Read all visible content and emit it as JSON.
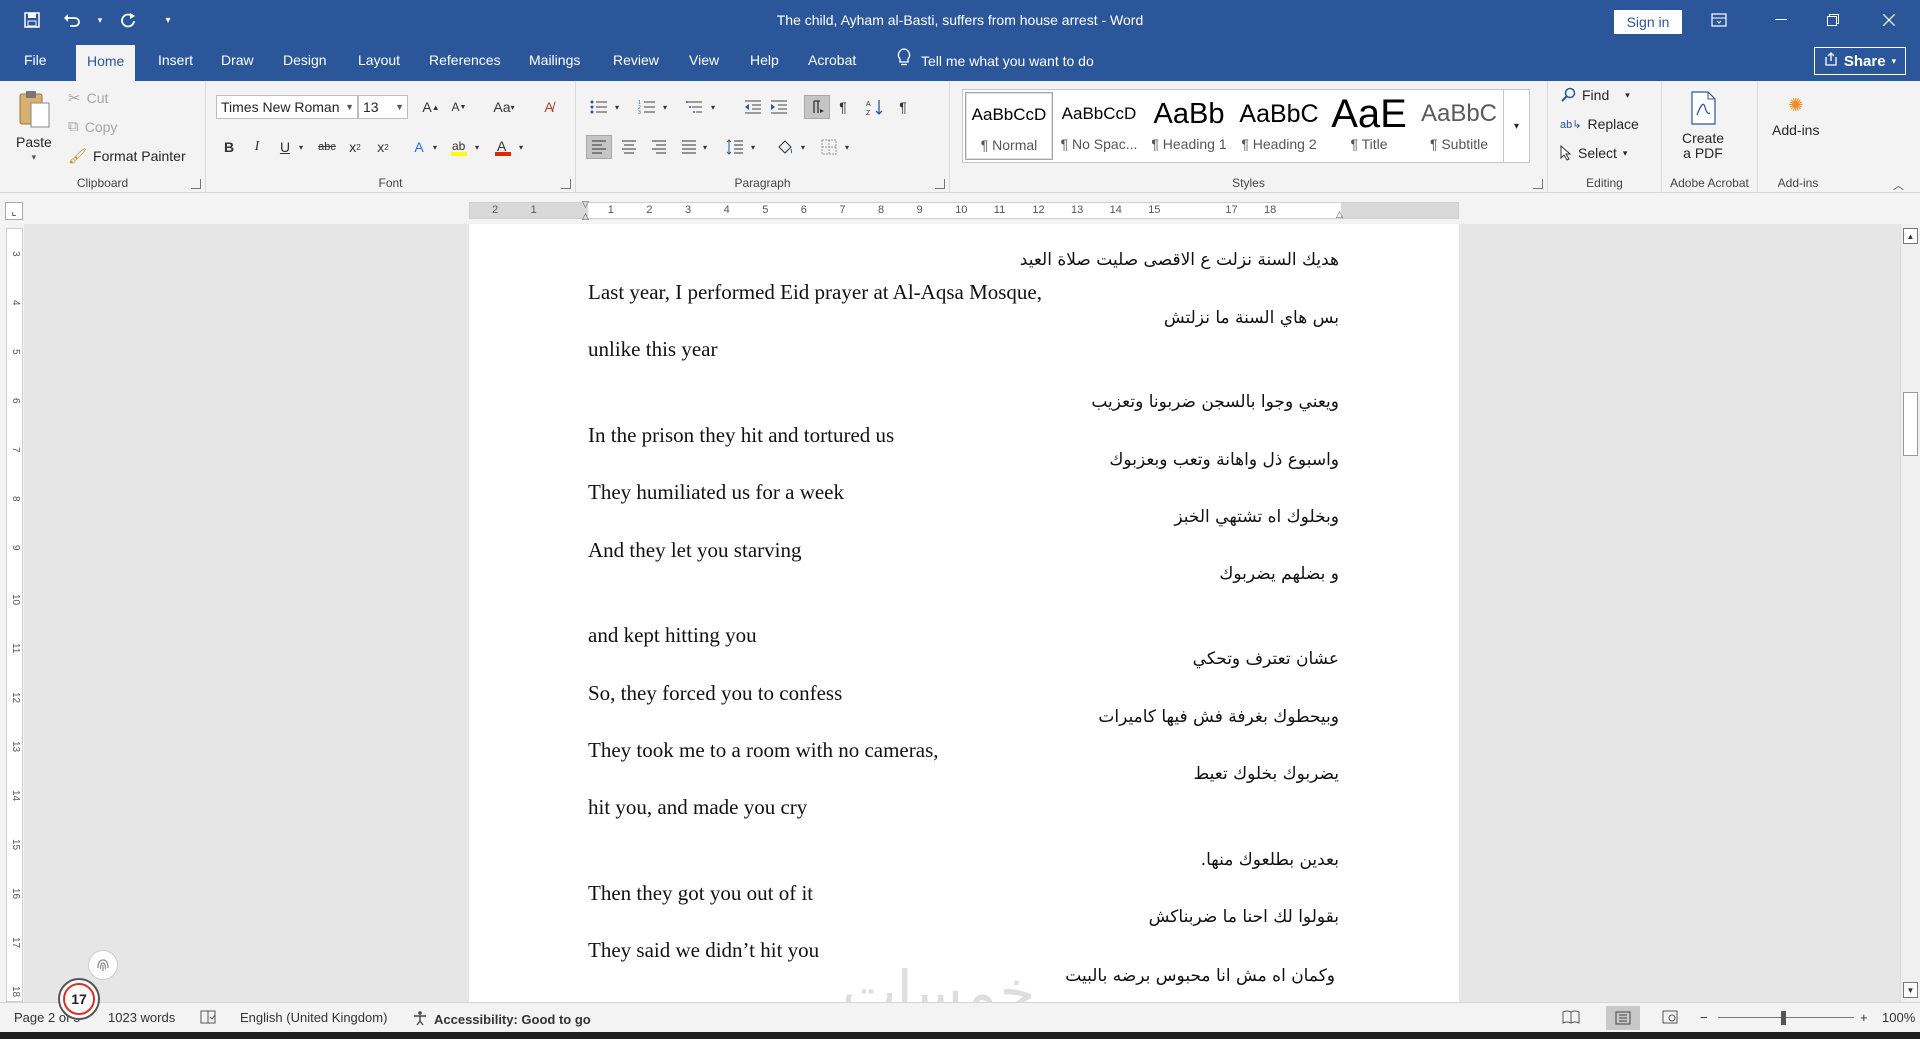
{
  "titlebar": {
    "title": "The child, Ayham al-Basti, suffers from house arrest  -  Word",
    "sign_in": "Sign in",
    "qat_icons": [
      "save-icon",
      "undo-icon",
      "redo-icon",
      "customize-icon"
    ]
  },
  "tabs": [
    "File",
    "Home",
    "Insert",
    "Draw",
    "Design",
    "Layout",
    "References",
    "Mailings",
    "Review",
    "View",
    "Help",
    "Acrobat"
  ],
  "active_tab": "Home",
  "tell_me": "Tell me what you want to do",
  "share": "Share",
  "clipboard": {
    "label": "Clipboard",
    "paste": "Paste",
    "cut": "Cut",
    "copy": "Copy",
    "format_painter": "Format Painter"
  },
  "font": {
    "label": "Font",
    "name": "Times New Roman",
    "size": "13"
  },
  "paragraph": {
    "label": "Paragraph"
  },
  "styles": {
    "label": "Styles",
    "items": [
      {
        "preview": "AaBbCcD",
        "name": "¶ Normal"
      },
      {
        "preview": "AaBbCcD",
        "name": "¶ No Spac..."
      },
      {
        "preview": "AaBb",
        "name": "¶ Heading 1"
      },
      {
        "preview": "AaBbC",
        "name": "¶ Heading 2"
      },
      {
        "preview": "AaE",
        "name": "¶ Title"
      },
      {
        "preview": "AaBbC",
        "name": "¶ Subtitle"
      }
    ]
  },
  "editing": {
    "label": "Editing",
    "find": "Find",
    "replace": "Replace",
    "select": "Select"
  },
  "acrobat": {
    "label": "Adobe Acrobat",
    "create_line1": "Create",
    "create_line2": "a PDF"
  },
  "addins": {
    "label": "Add-ins",
    "button": "Add-ins"
  },
  "ruler_numbers": [
    "2",
    "1",
    "",
    "1",
    "2",
    "3",
    "4",
    "5",
    "6",
    "7",
    "8",
    "9",
    "10",
    "11",
    "12",
    "13",
    "14",
    "15",
    "",
    "17",
    "18"
  ],
  "document": {
    "lines": [
      {
        "lang": "ar",
        "text": "هديك السنة نزلت ع الاقصى صليت صلاة العيد"
      },
      {
        "lang": "en",
        "text": "Last year, I performed Eid prayer at Al-Aqsa Mosque,"
      },
      {
        "lang": "ar",
        "text": "بس هاي السنة ما نزلتش"
      },
      {
        "lang": "en",
        "text": "unlike this year"
      },
      {
        "lang": "ar",
        "text": "ويعني وجوا بالسجن ضربونا وتعزيب"
      },
      {
        "lang": "en",
        "text": "In the prison they hit and tortured us"
      },
      {
        "lang": "ar",
        "text": "واسبوع ذل واهانة وتعب وبعزبوك"
      },
      {
        "lang": "en",
        "text": "They humiliated us for a week"
      },
      {
        "lang": "ar",
        "text": "وبخلوك اه تشتهي الخبز"
      },
      {
        "lang": "en",
        "text": "And they let you starving"
      },
      {
        "lang": "ar",
        "text": "و بضلهم يضربوك"
      },
      {
        "lang": "en",
        "text": "and kept hitting you"
      },
      {
        "lang": "ar",
        "text": "عشان تعترف وتحكي"
      },
      {
        "lang": "en",
        "text": "So, they forced you to confess"
      },
      {
        "lang": "ar",
        "text": "وبيحطوك بغرفة فش فيها كاميرات"
      },
      {
        "lang": "en",
        "text": "They took me to a room with no cameras,"
      },
      {
        "lang": "ar",
        "text": "يضربوك بخلوك تعيط"
      },
      {
        "lang": "en",
        "text": " hit you, and made you cry"
      },
      {
        "lang": "ar",
        "text": "بعدين بطلعوك منها."
      },
      {
        "lang": "en",
        "text": "Then they got you out of it"
      },
      {
        "lang": "ar",
        "text": "بقولوا لك احنا ما ضربناكش"
      },
      {
        "lang": "en",
        "text": "They said we didn’t hit you"
      },
      {
        "lang": "ar",
        "text": "وكمان اه مش انا محبوس برضه بالبيت"
      }
    ]
  },
  "statusbar": {
    "page": "Page 2 of 5",
    "words": "1023 words",
    "language": "English (United Kingdom)",
    "accessibility": "Accessibility: Good to go",
    "zoom": "100%"
  },
  "overlay": {
    "badge_count": "17",
    "watermark": "خمسات"
  }
}
